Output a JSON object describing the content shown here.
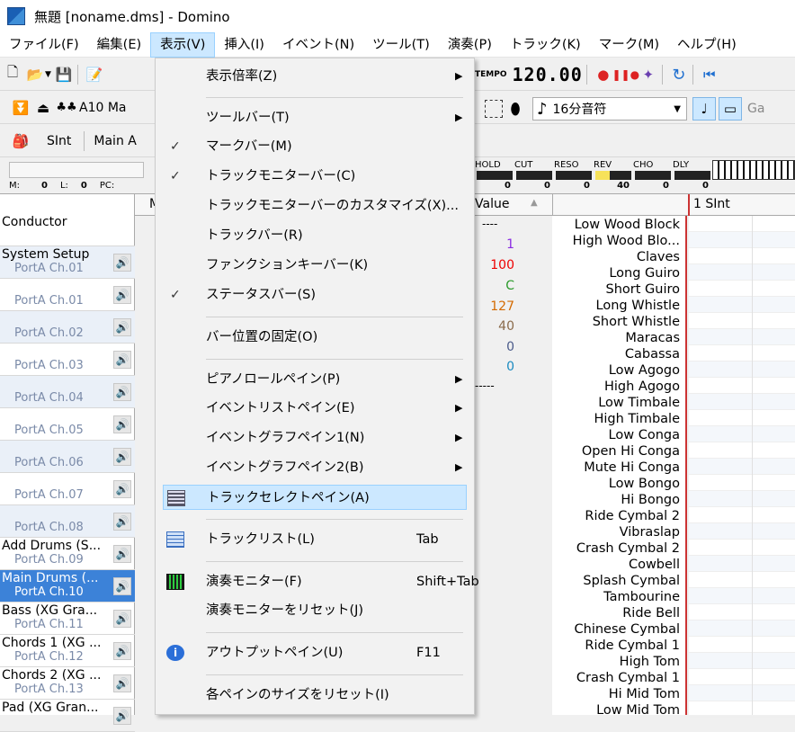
{
  "window": {
    "title": "無題 [noname.dms] - Domino"
  },
  "menubar": [
    "ファイル(F)",
    "編集(E)",
    "表示(V)",
    "挿入(I)",
    "イベント(N)",
    "ツール(T)",
    "演奏(P)",
    "トラック(K)",
    "マーク(M)",
    "ヘルプ(H)"
  ],
  "toolbar": {
    "tempo_label": "TEMPO",
    "tempo_value": "120.00",
    "instrument": "A10 Ma",
    "note_length": "16分音符",
    "gap_label": "Ga"
  },
  "toolbar3": {
    "track_name": "SInt",
    "port": "Main A"
  },
  "monitor": {
    "m_label": "M:",
    "m_value": "0",
    "l_label": "L:",
    "l_value": "0",
    "pc_label": "PC:",
    "params": [
      {
        "label": "HOLD",
        "value": "0"
      },
      {
        "label": "CUT",
        "value": "0"
      },
      {
        "label": "RESO",
        "value": "0"
      },
      {
        "label": "REV",
        "value": "40"
      },
      {
        "label": "CHO",
        "value": "0"
      },
      {
        "label": "DLY",
        "value": "0"
      }
    ]
  },
  "event_list": {
    "col_value": "Value",
    "values": [
      "----",
      "1",
      "100",
      "C",
      "127",
      "40",
      "0",
      "0",
      "-----"
    ]
  },
  "track_header": {
    "col_m": "M"
  },
  "piano_header": {
    "track": "1 SInt"
  },
  "view_menu": {
    "items": [
      {
        "label": "表示倍率(Z)",
        "arrow": "▶"
      },
      {
        "label": "ツールバー(T)",
        "arrow": "▶"
      },
      {
        "label": "マークバー(M)",
        "checked": "✓"
      },
      {
        "label": "トラックモニターバー(C)",
        "checked": "✓"
      },
      {
        "label": "トラックモニターバーのカスタマイズ(X)..."
      },
      {
        "label": "トラックバー(R)"
      },
      {
        "label": "ファンクションキーバー(K)"
      },
      {
        "label": "ステータスバー(S)",
        "checked": "✓"
      },
      {
        "label": "バー位置の固定(O)"
      },
      {
        "label": "ピアノロールペイン(P)",
        "arrow": "▶"
      },
      {
        "label": "イベントリストペイン(E)",
        "arrow": "▶"
      },
      {
        "label": "イベントグラフペイン1(N)",
        "arrow": "▶"
      },
      {
        "label": "イベントグラフペイン2(B)",
        "arrow": "▶"
      },
      {
        "label": "トラックセレクトペイン(A)"
      },
      {
        "label": "トラックリスト(L)",
        "shortcut": "Tab"
      },
      {
        "label": "演奏モニター(F)",
        "shortcut": "Shift+Tab"
      },
      {
        "label": "演奏モニターをリセット(J)"
      },
      {
        "label": "アウトプットペイン(U)",
        "shortcut": "F11"
      },
      {
        "label": "各ペインのサイズをリセット(I)"
      }
    ]
  },
  "tracks": [
    {
      "name": "Conductor",
      "ch": ""
    },
    {
      "name": "System Setup",
      "ch": "PortA  Ch.01"
    },
    {
      "name": "",
      "ch": "PortA  Ch.01"
    },
    {
      "name": "",
      "ch": "PortA  Ch.02"
    },
    {
      "name": "",
      "ch": "PortA  Ch.03"
    },
    {
      "name": "",
      "ch": "PortA  Ch.04"
    },
    {
      "name": "",
      "ch": "PortA  Ch.05"
    },
    {
      "name": "",
      "ch": "PortA  Ch.06"
    },
    {
      "name": "",
      "ch": "PortA  Ch.07"
    },
    {
      "name": "",
      "ch": "PortA  Ch.08"
    },
    {
      "name": "Add Drums (S...",
      "ch": "PortA  Ch.09"
    },
    {
      "name": "Main Drums (...",
      "ch": "PortA  Ch.10"
    },
    {
      "name": "Bass (XG Gra...",
      "ch": "PortA  Ch.11"
    },
    {
      "name": "Chords 1 (XG ...",
      "ch": "PortA  Ch.12"
    },
    {
      "name": "Chords 2 (XG ...",
      "ch": "PortA  Ch.13"
    },
    {
      "name": "Pad (XG Gran...",
      "ch": ""
    }
  ],
  "drums": [
    "Low Wood Block",
    "High Wood Blo...",
    "Claves",
    "Long Guiro",
    "Short Guiro",
    "Long Whistle",
    "Short Whistle",
    "Maracas",
    "Cabassa",
    "Low Agogo",
    "High Agogo",
    "Low Timbale",
    "High Timbale",
    "Low Conga",
    "Open Hi Conga",
    "Mute Hi Conga",
    "Low Bongo",
    "Hi Bongo",
    "Ride Cymbal 2",
    "Vibraslap",
    "Crash Cymbal 2",
    "Cowbell",
    "Splash Cymbal",
    "Tambourine",
    "Ride Bell",
    "Chinese Cymbal",
    "Ride Cymbal 1",
    "High Tom",
    "Crash Cymbal 1",
    "Hi Mid Tom",
    "Low Mid Tom"
  ]
}
